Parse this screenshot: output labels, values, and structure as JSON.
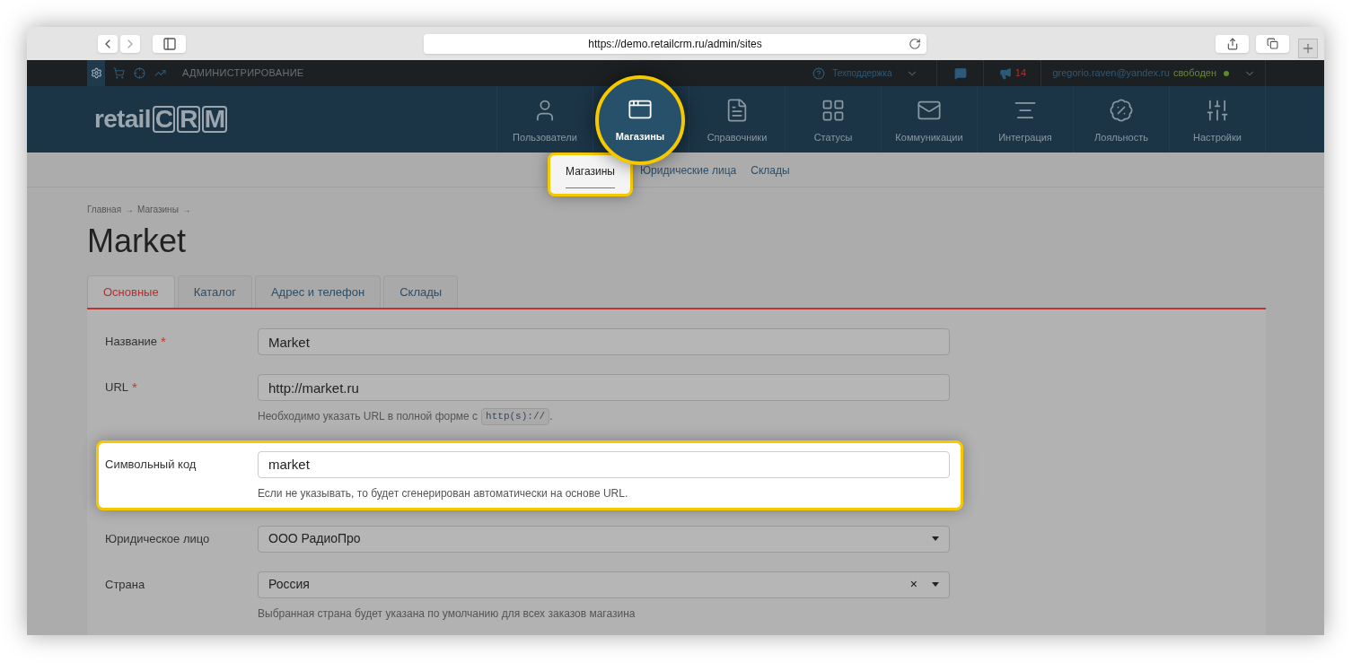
{
  "browser": {
    "url": "https://demo.retailcrm.ru/admin/sites"
  },
  "top_bar": {
    "section": "АДМИНИСТРИРОВАНИЕ",
    "support": "Техподдержка",
    "notifications": "14",
    "user": "gregorio.raven@yandex.ru",
    "status": "свободен"
  },
  "logo": {
    "text": "retail",
    "boxed": "CRM"
  },
  "nav": [
    {
      "label": "Пользователи",
      "selected": false
    },
    {
      "label": "Магазины",
      "selected": true
    },
    {
      "label": "Справочники",
      "selected": false
    },
    {
      "label": "Статусы",
      "selected": false
    },
    {
      "label": "Коммуникации",
      "selected": false
    },
    {
      "label": "Интеграция",
      "selected": false
    },
    {
      "label": "Лояльность",
      "selected": false
    },
    {
      "label": "Настройки",
      "selected": false
    }
  ],
  "subnav": [
    {
      "label": "Магазины",
      "selected": true
    },
    {
      "label": "Юридические лица",
      "selected": false
    },
    {
      "label": "Склады",
      "selected": false
    }
  ],
  "breadcrumb": {
    "items": [
      "Главная",
      "Магазины"
    ],
    "separator": "→"
  },
  "title": "Market",
  "tabs": [
    {
      "label": "Основные",
      "selected": true
    },
    {
      "label": "Каталог",
      "selected": false
    },
    {
      "label": "Адрес и телефон",
      "selected": false
    },
    {
      "label": "Склады",
      "selected": false
    }
  ],
  "form": [
    {
      "kind": "text",
      "label": "Название",
      "required": true,
      "required_mark": "*",
      "value": "Market",
      "highlighted": false
    },
    {
      "kind": "text",
      "label": "URL",
      "required": true,
      "required_mark": "*",
      "value": "http://market.ru",
      "highlighted": false,
      "hint": {
        "text": "Необходимо указать URL в полной форме с",
        "code": "http(s)://",
        "after": "."
      }
    },
    {
      "kind": "text",
      "label": "Символьный код",
      "required": false,
      "value": "market",
      "highlighted": true,
      "hint": {
        "text": "Если не указывать, то будет сгенерирован автоматически на основе URL."
      }
    },
    {
      "kind": "select",
      "label": "Юридическое лицо",
      "required": false,
      "value": "ООО РадиоПро",
      "highlighted": false
    },
    {
      "kind": "select",
      "label": "Страна",
      "required": false,
      "value": "Россия",
      "highlighted": false,
      "clear": "×",
      "hint": {
        "text": "Выбранная страна будет указана по умолчанию для всех заказов магазина"
      }
    }
  ]
}
